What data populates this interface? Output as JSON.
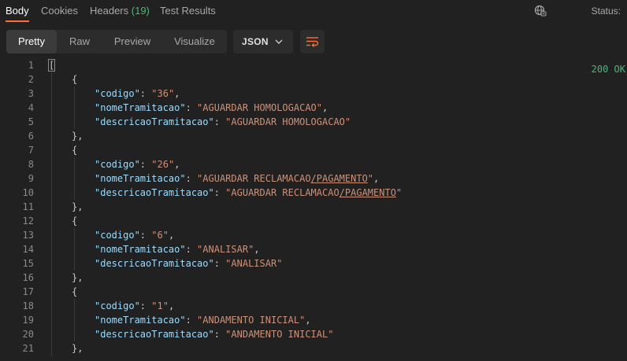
{
  "tabs": [
    {
      "label": "Body"
    },
    {
      "label": "Cookies"
    },
    {
      "label": "Headers",
      "count": "(19)"
    },
    {
      "label": "Test Results"
    }
  ],
  "status": {
    "label": "Status:",
    "value": "200 OK"
  },
  "view_modes": [
    "Pretty",
    "Raw",
    "Preview",
    "Visualize"
  ],
  "format": {
    "selected": "JSON"
  },
  "icons": {
    "globe": "network-globe-icon",
    "wrap": "wrap-lines-icon",
    "chevron": "chevron-down-icon"
  },
  "colors": {
    "accent": "#ff6c37",
    "status_ok": "#4cb878",
    "json_key": "#9cdcfe",
    "json_string": "#ce9178"
  },
  "code_lines": [
    {
      "n": "1",
      "indent": 0,
      "open": "["
    },
    {
      "n": "2",
      "indent": 1,
      "open": "{"
    },
    {
      "n": "3",
      "indent": 2,
      "key": "codigo",
      "value": "36",
      "comma": ","
    },
    {
      "n": "4",
      "indent": 2,
      "key": "nomeTramitacao",
      "value": "AGUARDAR HOMOLOGACAO",
      "comma": ","
    },
    {
      "n": "5",
      "indent": 2,
      "key": "descricaoTramitacao",
      "value": "AGUARDAR HOMOLOGACAO",
      "comma": ""
    },
    {
      "n": "6",
      "indent": 1,
      "close": "},"
    },
    {
      "n": "7",
      "indent": 1,
      "open": "{"
    },
    {
      "n": "8",
      "indent": 2,
      "key": "codigo",
      "value": "26",
      "comma": ","
    },
    {
      "n": "9",
      "indent": 2,
      "key": "nomeTramitacao",
      "value": "AGUARDAR RECLAMACAO",
      "value_link": "/PAGAMENTO",
      "comma": ","
    },
    {
      "n": "10",
      "indent": 2,
      "key": "descricaoTramitacao",
      "value": "AGUARDAR RECLAMACAO",
      "value_link": "/PAGAMENTO",
      "comma": ""
    },
    {
      "n": "11",
      "indent": 1,
      "close": "},"
    },
    {
      "n": "12",
      "indent": 1,
      "open": "{"
    },
    {
      "n": "13",
      "indent": 2,
      "key": "codigo",
      "value": "6",
      "comma": ","
    },
    {
      "n": "14",
      "indent": 2,
      "key": "nomeTramitacao",
      "value": "ANALISAR",
      "comma": ","
    },
    {
      "n": "15",
      "indent": 2,
      "key": "descricaoTramitacao",
      "value": "ANALISAR",
      "comma": ""
    },
    {
      "n": "16",
      "indent": 1,
      "close": "},"
    },
    {
      "n": "17",
      "indent": 1,
      "open": "{"
    },
    {
      "n": "18",
      "indent": 2,
      "key": "codigo",
      "value": "1",
      "comma": ","
    },
    {
      "n": "19",
      "indent": 2,
      "key": "nomeTramitacao",
      "value": "ANDAMENTO INICIAL",
      "comma": ","
    },
    {
      "n": "20",
      "indent": 2,
      "key": "descricaoTramitacao",
      "value": "ANDAMENTO INICIAL",
      "comma": ""
    },
    {
      "n": "21",
      "indent": 1,
      "close": "},"
    }
  ]
}
